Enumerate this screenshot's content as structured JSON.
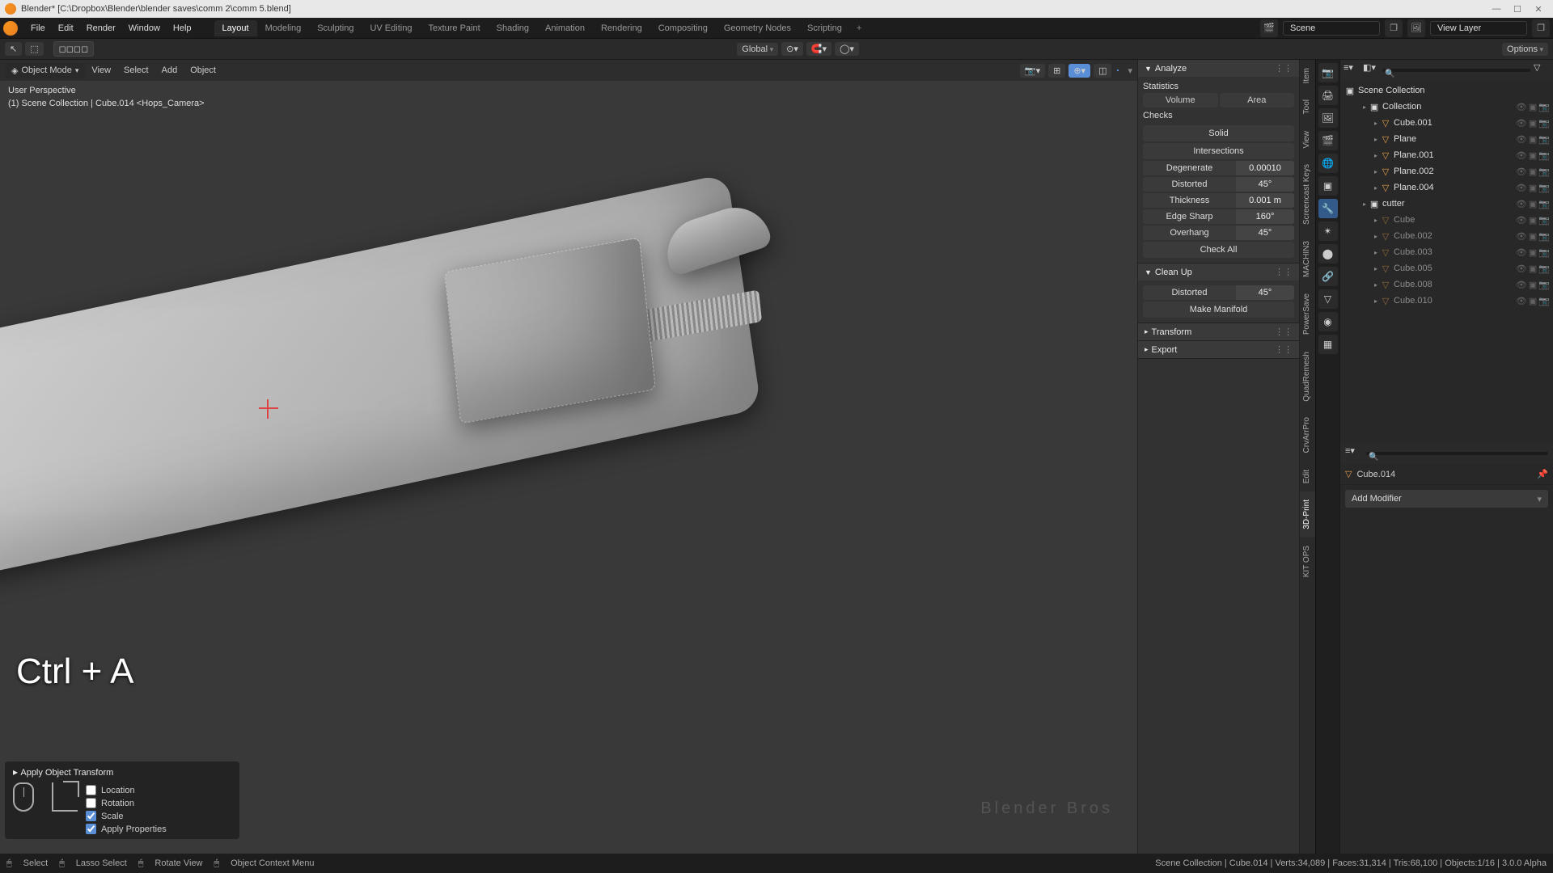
{
  "title": "Blender* [C:\\Dropbox\\Blender\\blender saves\\comm 2\\comm 5.blend]",
  "menus": {
    "file": "File",
    "edit": "Edit",
    "render": "Render",
    "window": "Window",
    "help": "Help"
  },
  "workspace_tabs": [
    "Layout",
    "Modeling",
    "Sculpting",
    "UV Editing",
    "Texture Paint",
    "Shading",
    "Animation",
    "Rendering",
    "Compositing",
    "Geometry Nodes",
    "Scripting"
  ],
  "workspace_active": "Layout",
  "scene_field": "Scene",
  "viewlayer_field": "View Layer",
  "toolheader": {
    "orientation": "Global",
    "snap": "",
    "options_label": "Options"
  },
  "mode": {
    "label": "Object Mode",
    "view": "View",
    "select": "Select",
    "add": "Add",
    "object": "Object"
  },
  "viewport_info": {
    "l1": "User Perspective",
    "l2": "(1) Scene Collection | Cube.014 <Hops_Camera>"
  },
  "hotkey": "Ctrl + A",
  "last_operator": {
    "title": "Apply Object Transform",
    "location": "Location",
    "rotation": "Rotation",
    "scale": "Scale",
    "apply_props": "Apply Properties"
  },
  "npanel": {
    "analyze": "Analyze",
    "statistics": "Statistics",
    "volume": "Volume",
    "area": "Area",
    "checks": "Checks",
    "solid": "Solid",
    "intersections": "Intersections",
    "rows": [
      {
        "label": "Degenerate",
        "val": "0.00010"
      },
      {
        "label": "Distorted",
        "val": "45°"
      },
      {
        "label": "Thickness",
        "val": "0.001 m"
      },
      {
        "label": "Edge Sharp",
        "val": "160°"
      },
      {
        "label": "Overhang",
        "val": "45°"
      }
    ],
    "check_all": "Check All",
    "cleanup": "Clean Up",
    "clean_rows": [
      {
        "label": "Distorted",
        "val": "45°"
      }
    ],
    "make_manifold": "Make Manifold",
    "transform": "Transform",
    "export": "Export"
  },
  "vtabs": [
    "Item",
    "Tool",
    "View",
    "Screencast Keys",
    "MACHIN3",
    "PowerSave",
    "QuadRemesh",
    "CrvArrPro",
    "Edit",
    "3D-Print",
    "KIT OPS"
  ],
  "vtab_active": "3D-Print",
  "outliner": {
    "collection_root": "Scene Collection",
    "items": [
      {
        "name": "Collection",
        "type": "collection",
        "indent": 1
      },
      {
        "name": "Cube.001",
        "type": "mesh",
        "indent": 2
      },
      {
        "name": "Plane",
        "type": "mesh",
        "indent": 2
      },
      {
        "name": "Plane.001",
        "type": "mesh",
        "indent": 2
      },
      {
        "name": "Plane.002",
        "type": "mesh",
        "indent": 2
      },
      {
        "name": "Plane.004",
        "type": "mesh",
        "indent": 2
      },
      {
        "name": "cutter",
        "type": "collection",
        "indent": 1
      },
      {
        "name": "Cube",
        "type": "mesh",
        "indent": 2,
        "dim": true
      },
      {
        "name": "Cube.002",
        "type": "mesh",
        "indent": 2,
        "dim": true
      },
      {
        "name": "Cube.003",
        "type": "mesh",
        "indent": 2,
        "dim": true
      },
      {
        "name": "Cube.005",
        "type": "mesh",
        "indent": 2,
        "dim": true
      },
      {
        "name": "Cube.008",
        "type": "mesh",
        "indent": 2,
        "dim": true
      },
      {
        "name": "Cube.010",
        "type": "mesh",
        "indent": 2,
        "dim": true
      }
    ]
  },
  "props": {
    "active_object": "Cube.014",
    "add_modifier": "Add Modifier"
  },
  "statusbar": {
    "select": "Select",
    "lasso": "Lasso Select",
    "rotate": "Rotate View",
    "context": "Object Context Menu",
    "stats": "Scene Collection | Cube.014 | Verts:34,089 | Faces:31,314 | Tris:68,100 | Objects:1/16 | 3.0.0 Alpha"
  },
  "branding": "Blender Bros"
}
